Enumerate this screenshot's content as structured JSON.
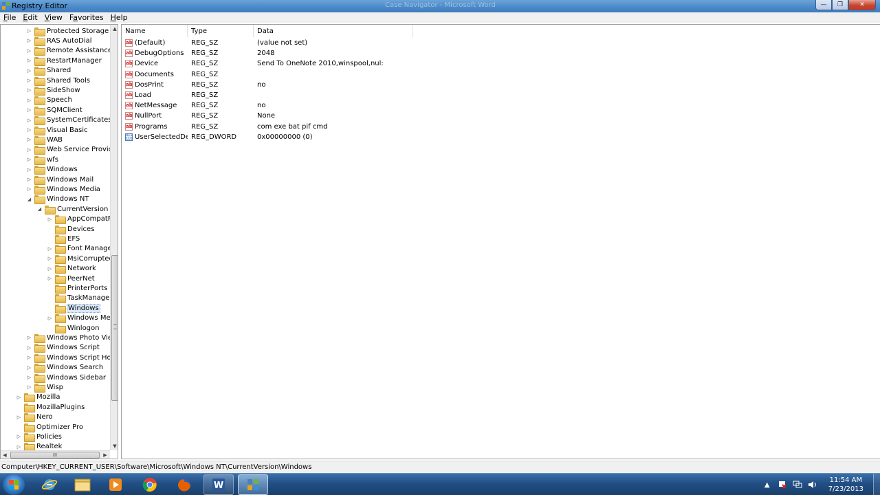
{
  "window": {
    "title": "Registry Editor",
    "bg_titles": [
      "Case Navigator - Microsoft Word"
    ]
  },
  "window_controls": {
    "minimize": "—",
    "maximize": "❐",
    "close": "✕"
  },
  "menu": [
    {
      "pre": "",
      "u": "F",
      "post": "ile"
    },
    {
      "pre": "",
      "u": "E",
      "post": "dit"
    },
    {
      "pre": "",
      "u": "V",
      "post": "iew"
    },
    {
      "pre": "F",
      "u": "a",
      "post": "vorites"
    },
    {
      "pre": "",
      "u": "H",
      "post": "elp"
    }
  ],
  "tree": [
    {
      "label": "Protected Storage Syst",
      "level": 1,
      "exp": "▷"
    },
    {
      "label": "RAS AutoDial",
      "level": 1,
      "exp": "▷"
    },
    {
      "label": "Remote Assistance",
      "level": 1,
      "exp": "▷"
    },
    {
      "label": "RestartManager",
      "level": 1,
      "exp": "▷"
    },
    {
      "label": "Shared",
      "level": 1,
      "exp": "▷"
    },
    {
      "label": "Shared Tools",
      "level": 1,
      "exp": "▷"
    },
    {
      "label": "SideShow",
      "level": 1,
      "exp": "▷"
    },
    {
      "label": "Speech",
      "level": 1,
      "exp": "▷"
    },
    {
      "label": "SQMClient",
      "level": 1,
      "exp": "▷"
    },
    {
      "label": "SystemCertificates",
      "level": 1,
      "exp": "▷"
    },
    {
      "label": "Visual Basic",
      "level": 1,
      "exp": "▷"
    },
    {
      "label": "WAB",
      "level": 1,
      "exp": "▷"
    },
    {
      "label": "Web Service Providers",
      "level": 1,
      "exp": "▷"
    },
    {
      "label": "wfs",
      "level": 1,
      "exp": "▷"
    },
    {
      "label": "Windows",
      "level": 1,
      "exp": "▷"
    },
    {
      "label": "Windows Mail",
      "level": 1,
      "exp": "▷"
    },
    {
      "label": "Windows Media",
      "level": 1,
      "exp": "▷"
    },
    {
      "label": "Windows NT",
      "level": 1,
      "exp": "◢"
    },
    {
      "label": "CurrentVersion",
      "level": 2,
      "exp": "◢"
    },
    {
      "label": "AppCompatFla",
      "level": 3,
      "exp": "▷"
    },
    {
      "label": "Devices",
      "level": 3,
      "exp": ""
    },
    {
      "label": "EFS",
      "level": 3,
      "exp": ""
    },
    {
      "label": "Font Managem",
      "level": 3,
      "exp": "▷"
    },
    {
      "label": "MsiCorruptedF",
      "level": 3,
      "exp": "▷"
    },
    {
      "label": "Network",
      "level": 3,
      "exp": "▷"
    },
    {
      "label": "PeerNet",
      "level": 3,
      "exp": "▷"
    },
    {
      "label": "PrinterPorts",
      "level": 3,
      "exp": ""
    },
    {
      "label": "TaskManager",
      "level": 3,
      "exp": ""
    },
    {
      "label": "Windows",
      "level": 3,
      "exp": "",
      "selected": true
    },
    {
      "label": "Windows Mess",
      "level": 3,
      "exp": "▷"
    },
    {
      "label": "Winlogon",
      "level": 3,
      "exp": ""
    },
    {
      "label": "Windows Photo Viewe",
      "level": 1,
      "exp": "▷"
    },
    {
      "label": "Windows Script",
      "level": 1,
      "exp": "▷"
    },
    {
      "label": "Windows Script Host",
      "level": 1,
      "exp": "▷"
    },
    {
      "label": "Windows Search",
      "level": 1,
      "exp": "▷"
    },
    {
      "label": "Windows Sidebar",
      "level": 1,
      "exp": "▷"
    },
    {
      "label": "Wisp",
      "level": 1,
      "exp": "▷"
    },
    {
      "label": "Mozilla",
      "level": 0,
      "exp": "▷"
    },
    {
      "label": "MozillaPlugins",
      "level": 0,
      "exp": ""
    },
    {
      "label": "Nero",
      "level": 0,
      "exp": "▷"
    },
    {
      "label": "Optimizer Pro",
      "level": 0,
      "exp": ""
    },
    {
      "label": "Policies",
      "level": 0,
      "exp": "▷"
    },
    {
      "label": "Realtek",
      "level": 0,
      "exp": "▷"
    }
  ],
  "scroll": {
    "up": "▲",
    "down": "▼",
    "left": "◀",
    "right": "▶",
    "h_grip": "III"
  },
  "columns": {
    "name": "Name",
    "type": "Type",
    "data": "Data"
  },
  "values": [
    {
      "name": "(Default)",
      "type": "REG_SZ",
      "data": "(value not set)",
      "icon": "ab"
    },
    {
      "name": "DebugOptions",
      "type": "REG_SZ",
      "data": "2048",
      "icon": "ab"
    },
    {
      "name": "Device",
      "type": "REG_SZ",
      "data": "Send To OneNote 2010,winspool,nul:",
      "icon": "ab"
    },
    {
      "name": "Documents",
      "type": "REG_SZ",
      "data": "",
      "icon": "ab"
    },
    {
      "name": "DosPrint",
      "type": "REG_SZ",
      "data": "no",
      "icon": "ab"
    },
    {
      "name": "Load",
      "type": "REG_SZ",
      "data": "",
      "icon": "ab"
    },
    {
      "name": "NetMessage",
      "type": "REG_SZ",
      "data": "no",
      "icon": "ab"
    },
    {
      "name": "NullPort",
      "type": "REG_SZ",
      "data": "None",
      "icon": "ab"
    },
    {
      "name": "Programs",
      "type": "REG_SZ",
      "data": "com exe bat pif cmd",
      "icon": "ab"
    },
    {
      "name": "UserSelectedDef...",
      "type": "REG_DWORD",
      "data": "0x00000000 (0)",
      "icon": "bin"
    }
  ],
  "status": "Computer\\HKEY_CURRENT_USER\\Software\\Microsoft\\Windows NT\\CurrentVersion\\Windows",
  "taskbar": {
    "apps": [
      {
        "name": "internet-explorer",
        "state": ""
      },
      {
        "name": "file-explorer",
        "state": ""
      },
      {
        "name": "media-player",
        "state": ""
      },
      {
        "name": "chrome",
        "state": ""
      },
      {
        "name": "firefox",
        "state": ""
      },
      {
        "name": "word",
        "state": "open"
      },
      {
        "name": "regedit",
        "state": "active"
      }
    ],
    "clock_time": "11:54 AM",
    "clock_date": "7/23/2013"
  }
}
